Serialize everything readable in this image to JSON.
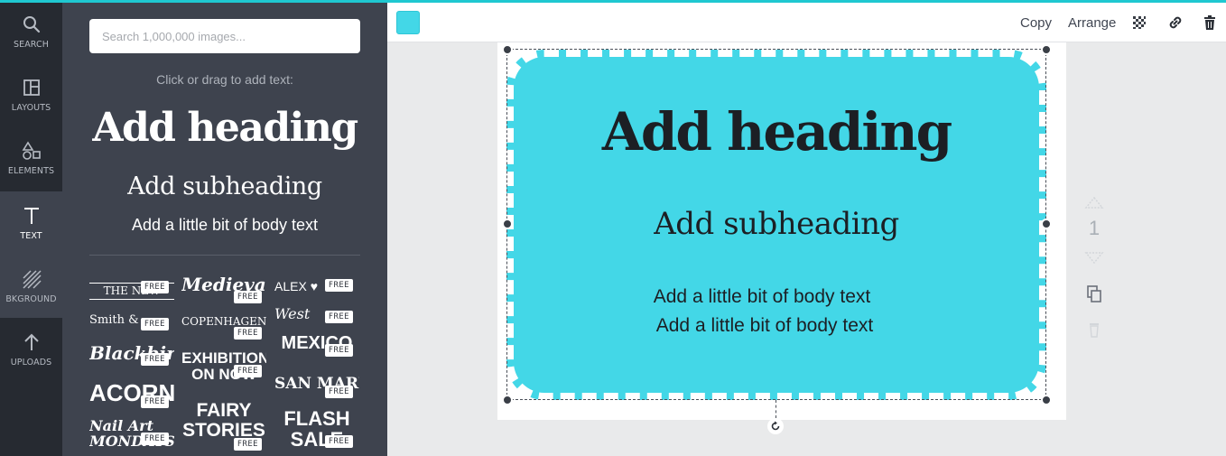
{
  "sidebar": {
    "items": [
      {
        "label": "SEARCH",
        "icon": "search-icon"
      },
      {
        "label": "LAYOUTS",
        "icon": "layouts-icon"
      },
      {
        "label": "ELEMENTS",
        "icon": "elements-icon"
      },
      {
        "label": "TEXT",
        "icon": "text-icon",
        "active": true
      },
      {
        "label": "BKGROUND",
        "icon": "background-icon"
      },
      {
        "label": "UPLOADS",
        "icon": "upload-icon"
      }
    ]
  },
  "panel": {
    "search_placeholder": "Search 1,000,000 images...",
    "hint": "Click or drag to add text:",
    "heading": "Add heading",
    "subheading": "Add subheading",
    "body": "Add a little bit of body text",
    "free_badge": "FREE",
    "templates": [
      {
        "text": "THE NEW"
      },
      {
        "text": "Medieval"
      },
      {
        "text": "ALEX ♥"
      },
      {
        "text": "Smith &"
      },
      {
        "text": "COPENHAGEN"
      },
      {
        "text": "West"
      },
      {
        "text": "Blackbird"
      },
      {
        "text": "EXHIBITION ON NOW"
      },
      {
        "text": "MEXICO"
      },
      {
        "text": "ACORN"
      },
      {
        "text": "FAIRY STORIES"
      },
      {
        "text": "SAN MARINO"
      },
      {
        "text": "Nail Art MONDAYS"
      },
      {
        "text": "FLASH SALE"
      }
    ]
  },
  "toolbar": {
    "color": "#43d7e7",
    "copy_label": "Copy",
    "arrange_label": "Arrange"
  },
  "canvas": {
    "heading": "Add heading",
    "subheading": "Add subheading",
    "body_lines": [
      "Add a little bit of body text",
      "Add a little bit of body text"
    ],
    "card_color": "#43d7e7"
  },
  "page_controls": {
    "page_number": "1"
  }
}
